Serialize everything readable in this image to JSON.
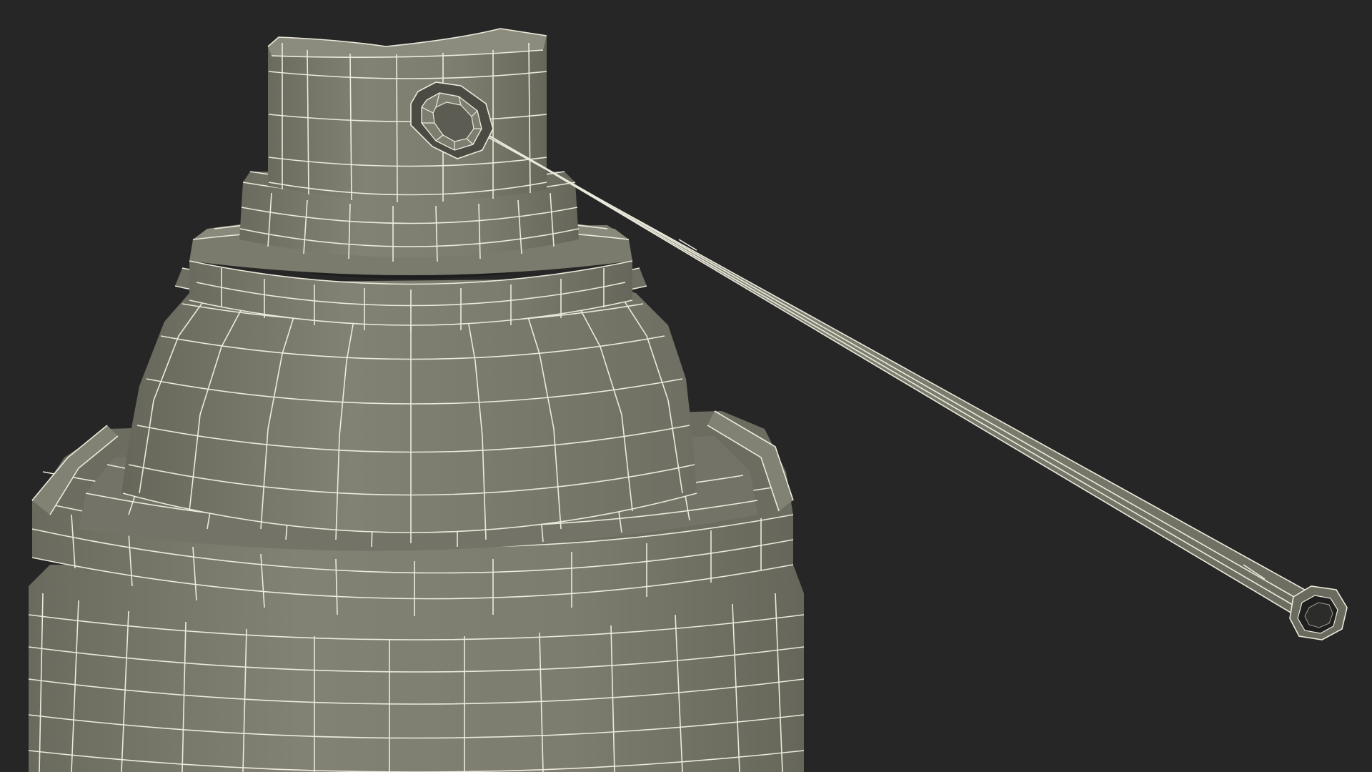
{
  "scene": {
    "subject": "aerosol-spray-can-with-straw-wireframe",
    "colors": {
      "background": "#262626",
      "mesh_fill": "#7b7b6e",
      "mesh_fill_light": "#8a8a7c",
      "mesh_fill_dark": "#5e5e53",
      "wire": "#eceadc",
      "shadow": "#1a1a1a"
    }
  }
}
